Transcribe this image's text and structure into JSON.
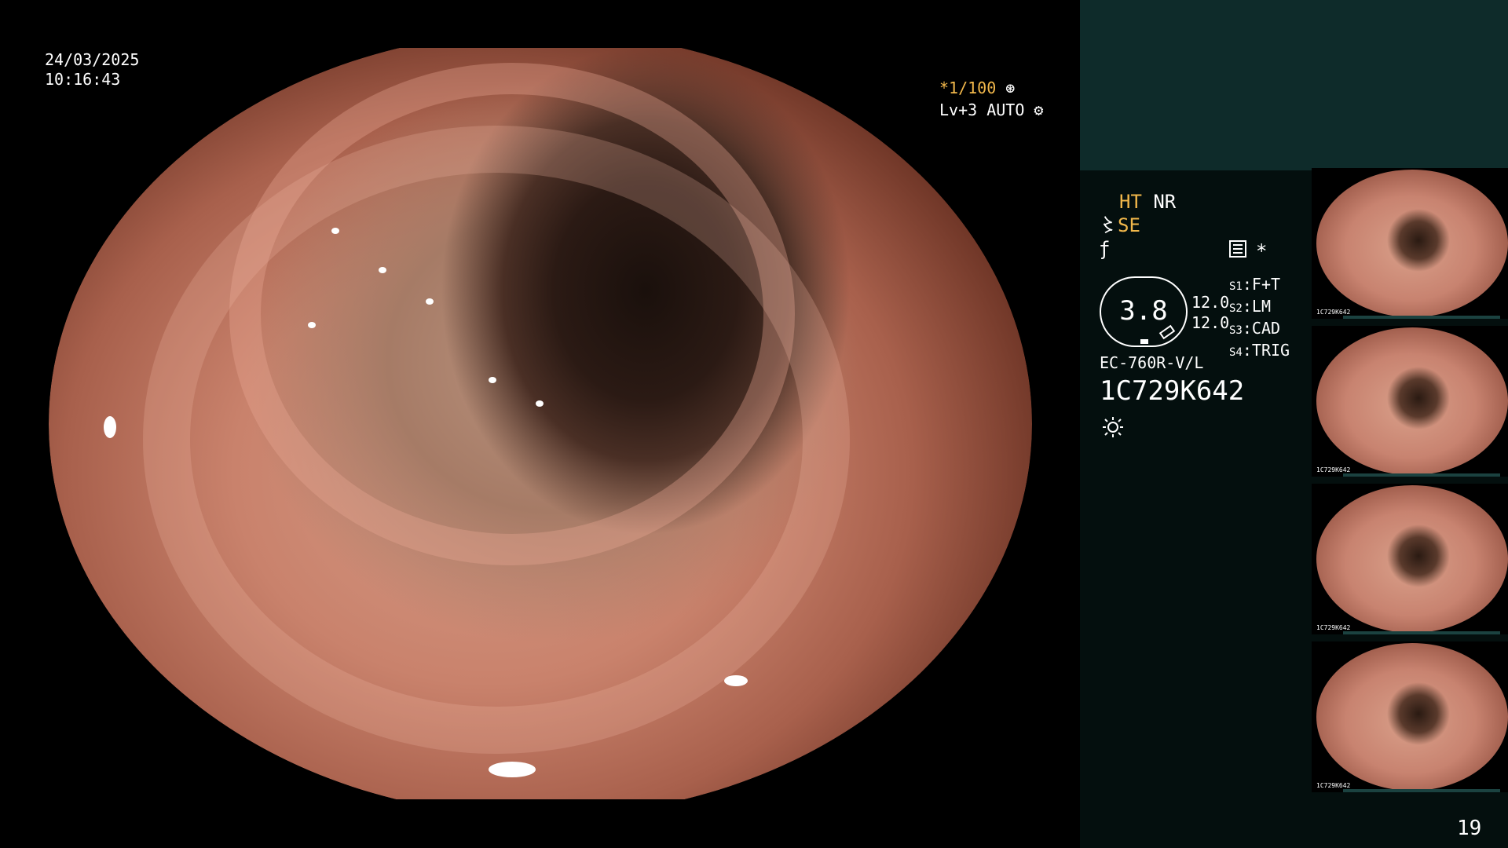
{
  "overlay": {
    "date": "24/03/2025",
    "time": "10:16:43",
    "shutter": "*1/100",
    "level": "Lv+3 AUTO"
  },
  "settings": {
    "ht": "HT",
    "nr": "NR",
    "se": "SE"
  },
  "gauge": {
    "value": "3.8",
    "left_value_top": "12.0",
    "left_value_bottom": "12.0",
    "star": "*"
  },
  "slots": [
    {
      "key": "S1",
      "value": "F+T"
    },
    {
      "key": "S2",
      "value": "LM"
    },
    {
      "key": "S3",
      "value": "CAD"
    },
    {
      "key": "S4",
      "value": "TRIG"
    }
  ],
  "scope": {
    "model": "EC-760R-V/L",
    "serial": "1C729K642"
  },
  "thumbnails": [
    {
      "label": "1C729K642"
    },
    {
      "label": "1C729K642"
    },
    {
      "label": "1C729K642"
    },
    {
      "label": "1C729K642"
    }
  ],
  "page_number": "19",
  "icons": {
    "shutter": "aperture-icon",
    "level": "gear-icon",
    "light": "sun-icon"
  }
}
